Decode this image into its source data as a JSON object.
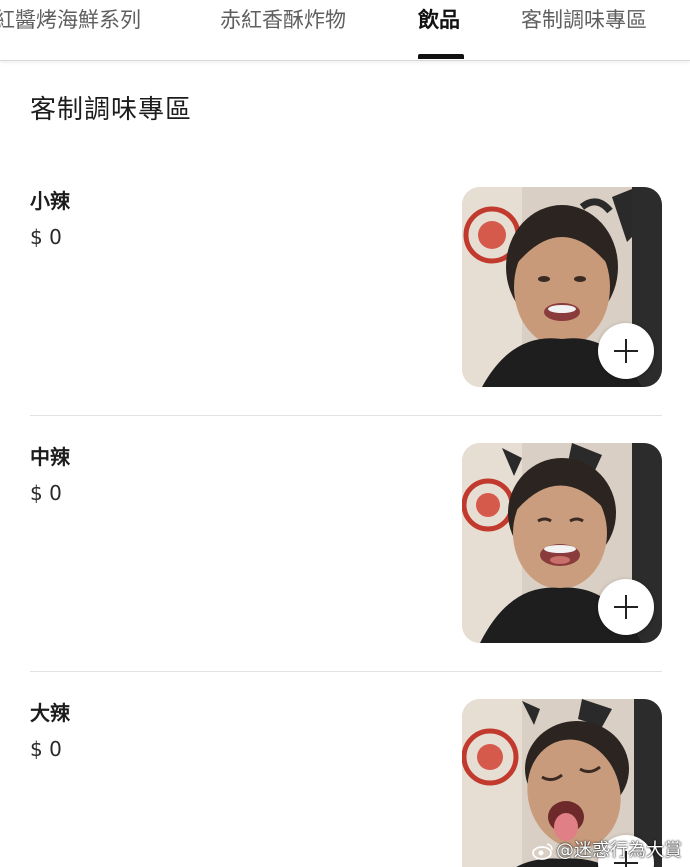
{
  "tabs": [
    {
      "label": "紅醬烤海鮮系列",
      "active": false
    },
    {
      "label": "赤紅香酥炸物",
      "active": false
    },
    {
      "label": "飲品",
      "active": true
    },
    {
      "label": "客制調味專區",
      "active": false
    }
  ],
  "section": {
    "title": "客制調味專區"
  },
  "items": [
    {
      "name": "小辣",
      "price": "$ 0",
      "image": "photo-portrait-smiling",
      "action_icon": "plus-icon"
    },
    {
      "name": "中辣",
      "price": "$ 0",
      "image": "photo-portrait-laughing",
      "action_icon": "plus-icon"
    },
    {
      "name": "大辣",
      "price": "$ 0",
      "image": "photo-portrait-tongue-out",
      "action_icon": "plus-icon"
    }
  ],
  "watermark": {
    "text": "@迷惑行為大賞",
    "icon": "weibo-icon"
  },
  "colors": {
    "active_tab": "#111111",
    "inactive_tab": "#5f5f5f",
    "divider": "#e2e2e2",
    "background": "#ffffff"
  }
}
